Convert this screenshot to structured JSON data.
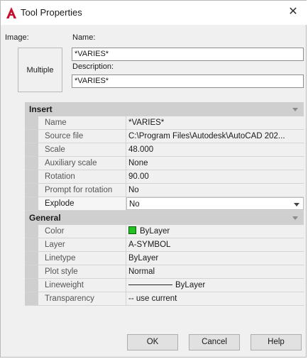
{
  "window": {
    "title": "Tool Properties",
    "close_glyph": "✕"
  },
  "image": {
    "label": "Image:",
    "preview_text": "Multiple"
  },
  "name": {
    "label": "Name:",
    "value": "*VARIES*"
  },
  "description": {
    "label": "Description:",
    "value": "*VARIES*"
  },
  "categories": {
    "insert": {
      "title": "Insert",
      "rows": [
        {
          "name": "Name",
          "value": "*VARIES*"
        },
        {
          "name": "Source file",
          "value": "C:\\Program  Files\\Autodesk\\AutoCAD 202..."
        },
        {
          "name": "Scale",
          "value": "48.000"
        },
        {
          "name": "Auxiliary scale",
          "value": "None"
        },
        {
          "name": "Rotation",
          "value": "90.00"
        },
        {
          "name": "Prompt for rotation",
          "value": "No"
        },
        {
          "name": "Explode",
          "value": "No"
        }
      ]
    },
    "general": {
      "title": "General",
      "rows": [
        {
          "name": "Color",
          "value": "ByLayer",
          "swatch_color": "#22c222"
        },
        {
          "name": "Layer",
          "value": "A-SYMBOL"
        },
        {
          "name": "Linetype",
          "value": "ByLayer"
        },
        {
          "name": "Plot style",
          "value": "Normal"
        },
        {
          "name": "Lineweight",
          "value": "ByLayer"
        },
        {
          "name": "Transparency",
          "value": "-- use current"
        }
      ]
    }
  },
  "buttons": {
    "ok": "OK",
    "cancel": "Cancel",
    "help": "Help"
  },
  "colors": {
    "autocad_red": "#c8102e",
    "category_bg": "#cfcfcf",
    "dialog_bg": "#f0f0f0"
  }
}
